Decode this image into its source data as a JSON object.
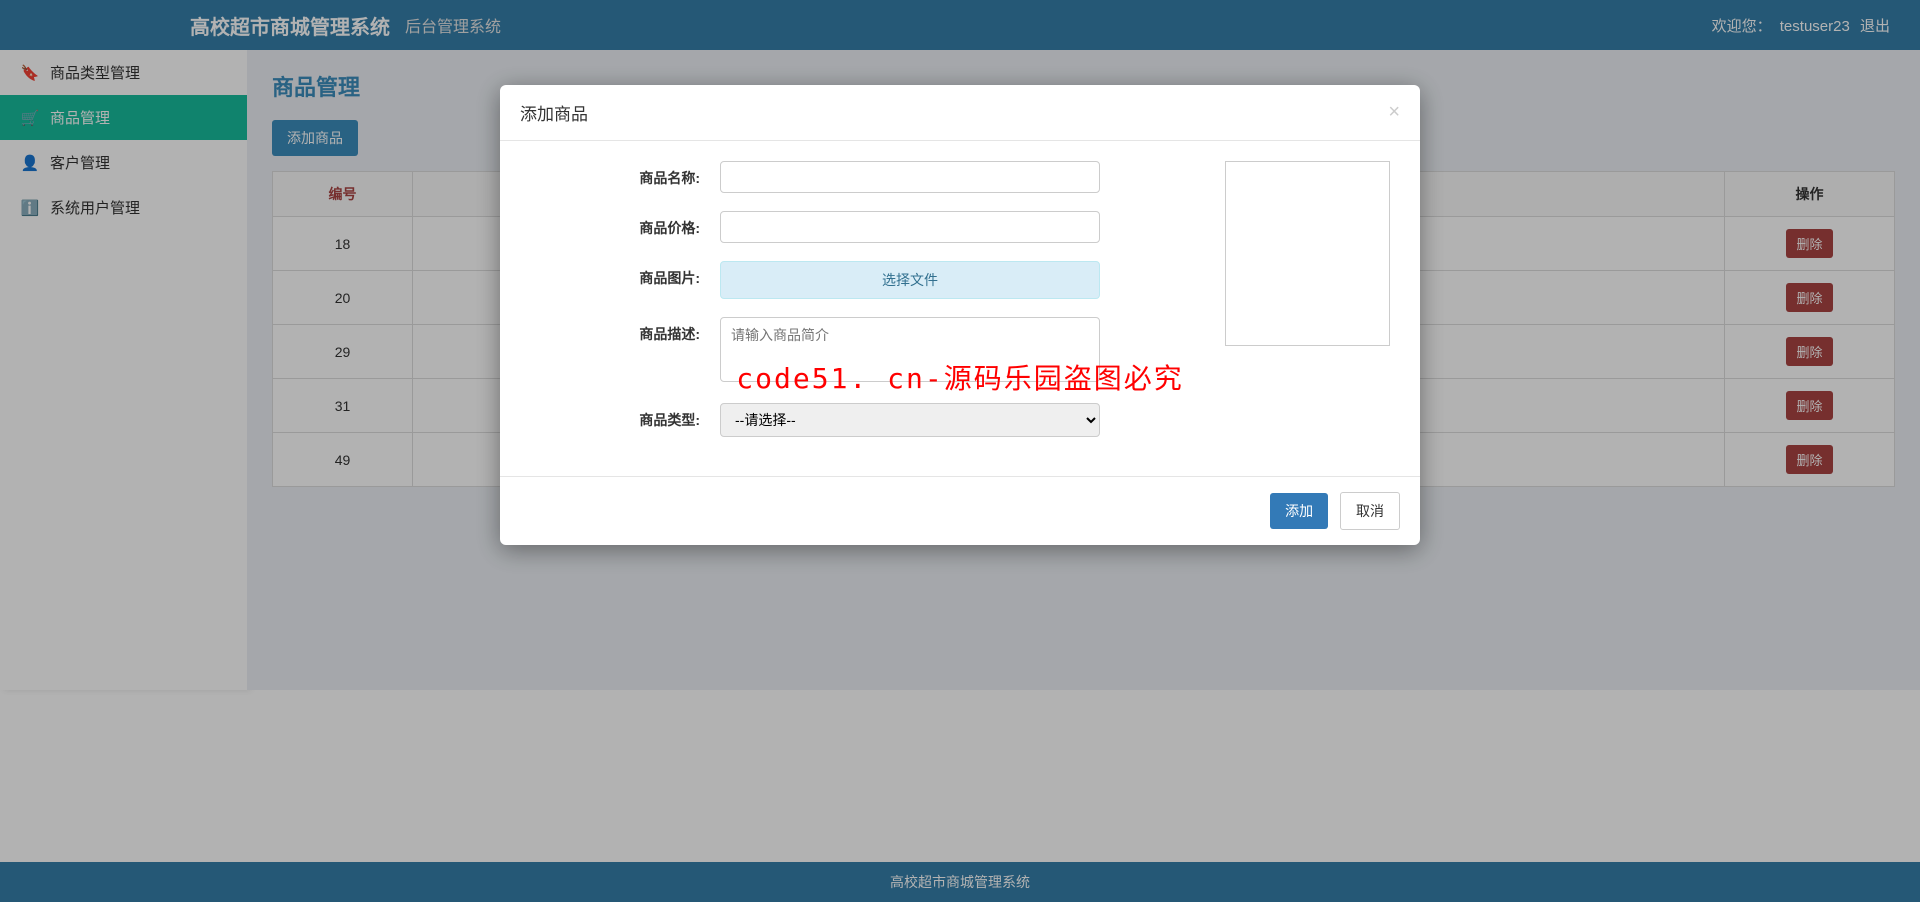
{
  "header": {
    "brand": "高校超市商城管理系统",
    "subtitle": "后台管理系统",
    "welcome_prefix": "欢迎您：",
    "username": "testuser23",
    "logout": "退出"
  },
  "sidebar": {
    "items": [
      {
        "label": "商品类型管理"
      },
      {
        "label": "商品管理"
      },
      {
        "label": "客户管理"
      },
      {
        "label": "系统用户管理"
      }
    ]
  },
  "main": {
    "page_title": "商品管理",
    "add_button": "添加商品",
    "table": {
      "header_id": "编号",
      "header_op": "操作",
      "rows": [
        {
          "id": "18"
        },
        {
          "id": "20"
        },
        {
          "id": "29"
        },
        {
          "id": "31"
        },
        {
          "id": "49"
        }
      ],
      "delete_label": "删除"
    }
  },
  "modal": {
    "title": "添加商品",
    "labels": {
      "name": "商品名称:",
      "price": "商品价格:",
      "image": "商品图片:",
      "desc": "商品描述:",
      "type": "商品类型:"
    },
    "file_button": "选择文件",
    "desc_placeholder": "请输入商品简介",
    "type_placeholder": "--请选择--",
    "submit": "添加",
    "cancel": "取消"
  },
  "footer": {
    "text": "高校超市商城管理系统"
  },
  "watermark": "code51. cn-源码乐园盗图必究"
}
